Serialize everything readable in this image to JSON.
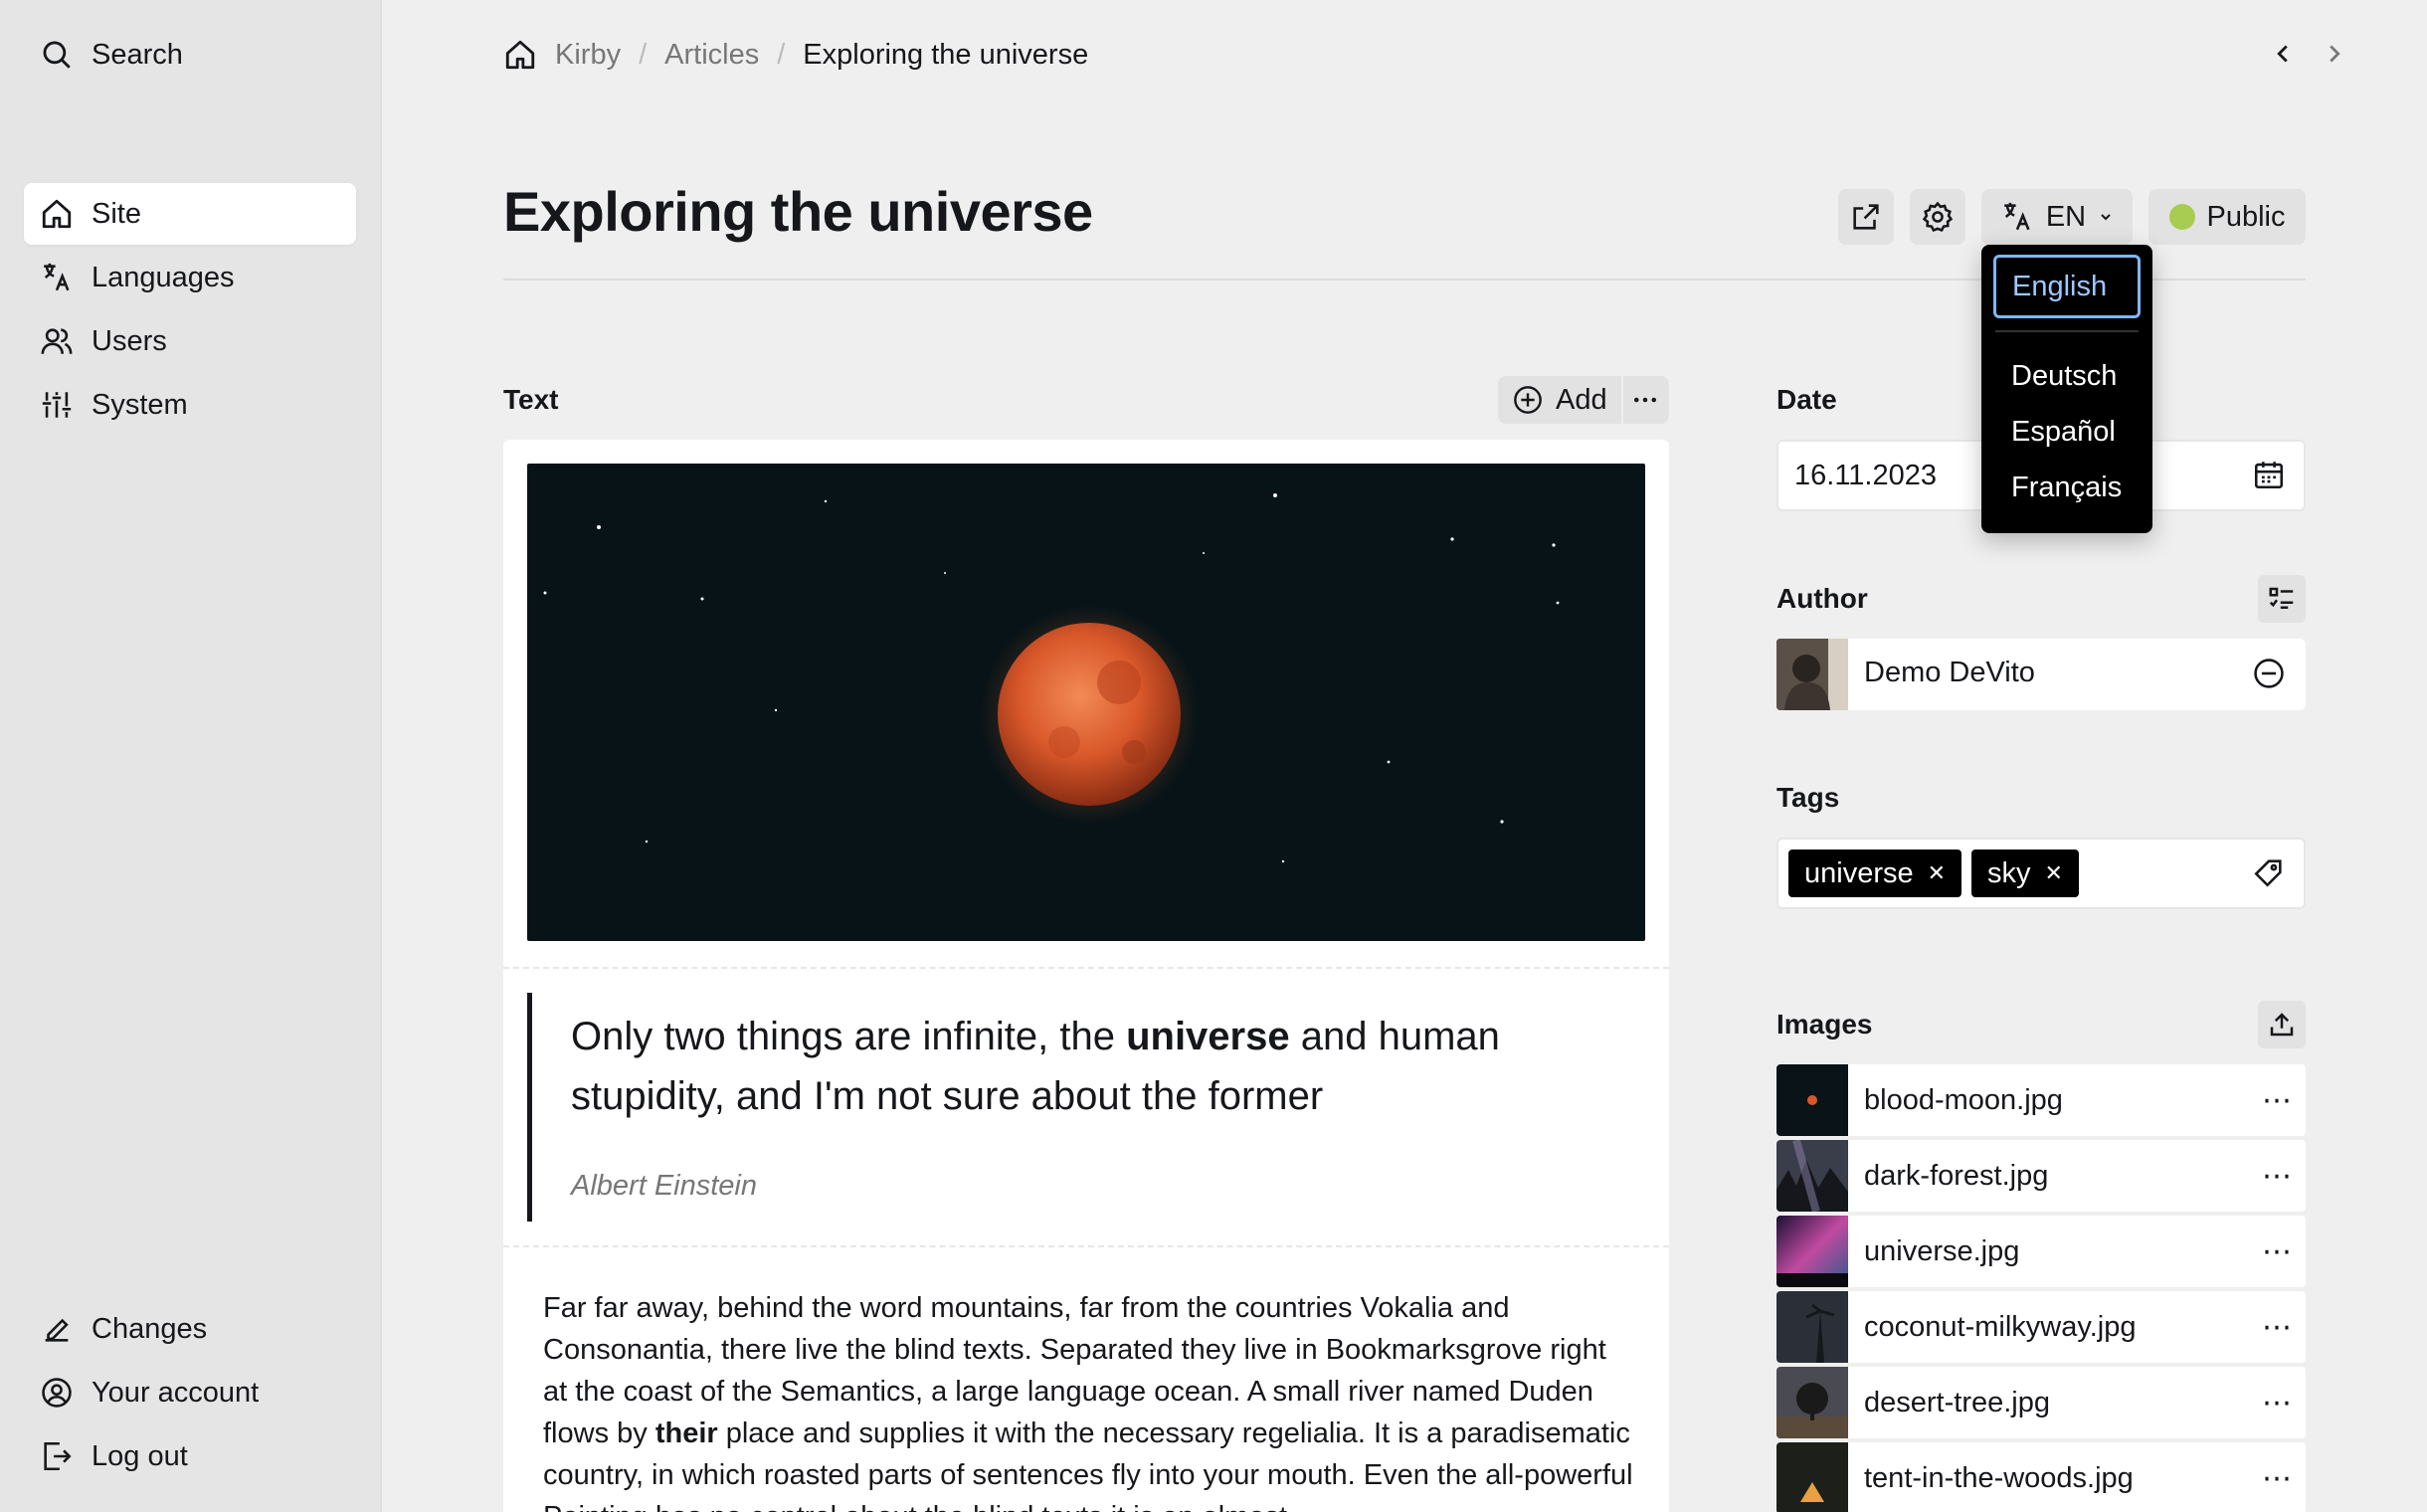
{
  "sidebar": {
    "top": [
      {
        "label": "Search",
        "icon": "search-icon"
      }
    ],
    "menu": [
      {
        "label": "Site",
        "icon": "home-icon"
      },
      {
        "label": "Languages",
        "icon": "translate-icon"
      },
      {
        "label": "Users",
        "icon": "users-icon"
      },
      {
        "label": "System",
        "icon": "sliders-icon"
      }
    ],
    "bottom": [
      {
        "label": "Changes",
        "icon": "pencil-icon"
      },
      {
        "label": "Your account",
        "icon": "account-icon"
      },
      {
        "label": "Log out",
        "icon": "logout-icon"
      }
    ]
  },
  "breadcrumb": {
    "home": "Kirby",
    "section": "Articles",
    "current": "Exploring the universe"
  },
  "page": {
    "title": "Exploring the universe"
  },
  "header_buttons": {
    "language": "EN",
    "status": "Public",
    "status_color": "#a7cc4f"
  },
  "language_dropdown": {
    "selected": "English",
    "options": [
      "Deutsch",
      "Español",
      "Français"
    ]
  },
  "text_field": {
    "label": "Text",
    "add_label": "Add",
    "quote_part1": "Only two things are infinite, the ",
    "quote_bold": "universe",
    "quote_part2": " and human stupidity, and I'm not sure about the former",
    "citation": "Albert Einstein",
    "body_1": "Far far away, behind the word mountains, far from the countries Vokalia and Consonantia, there live the blind texts. Separated they live in Bookmarksgrove right at the coast of the Semantics, a large language ocean. A small river named Duden flows by ",
    "body_bold": "their",
    "body_2": " place and supplies it with the necessary regelialia. It is a paradisematic country, in which roasted parts of sentences fly into your mouth. Even the all-powerful Pointing has no control about the blind texts it is an almost"
  },
  "date_field": {
    "label": "Date",
    "value": "16.11.2023"
  },
  "author_field": {
    "label": "Author",
    "name": "Demo DeVito"
  },
  "tags_field": {
    "label": "Tags",
    "tags": [
      "universe",
      "sky"
    ]
  },
  "images_field": {
    "label": "Images",
    "files": [
      "blood-moon.jpg",
      "dark-forest.jpg",
      "universe.jpg",
      "coconut-milkyway.jpg",
      "desert-tree.jpg",
      "tent-in-the-woods.jpg"
    ]
  }
}
